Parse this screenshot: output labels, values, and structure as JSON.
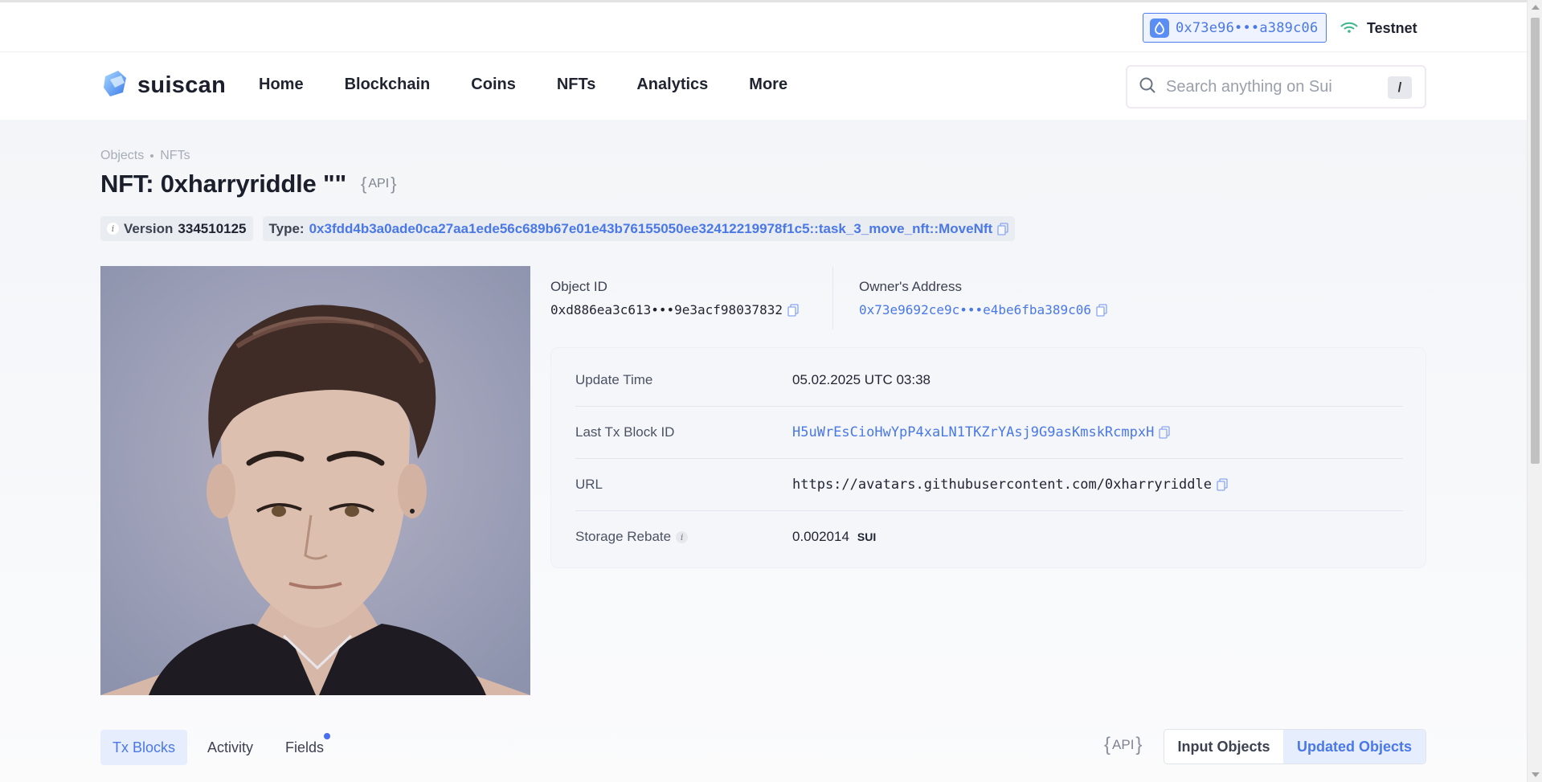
{
  "header": {
    "wallet_address": "0x73e96•••a389c06",
    "network": "Testnet"
  },
  "nav": {
    "logo_text": "suiscan",
    "links": [
      "Home",
      "Blockchain",
      "Coins",
      "NFTs",
      "Analytics",
      "More"
    ],
    "search_placeholder": "Search anything on Sui",
    "search_shortcut": "/"
  },
  "page": {
    "breadcrumb": [
      "Objects",
      "NFTs"
    ],
    "title": "NFT: 0xharryriddle \"\"",
    "api_label": "API",
    "version_label": "Version",
    "version_value": "334510125",
    "type_label": "Type:",
    "type_value": "0x3fdd4b3a0ade0ca27aa1ede56c689b67e01e43b76155050ee32412219978f1c5::task_3_move_nft::MoveNft"
  },
  "object": {
    "object_id_label": "Object ID",
    "object_id_value": "0xd886ea3c613•••9e3acf98037832",
    "owner_label": "Owner's Address",
    "owner_value": "0x73e9692ce9c•••e4be6fba389c06"
  },
  "details": [
    {
      "label": "Update Time",
      "value": "05.02.2025 UTC 03:38"
    },
    {
      "label": "Last Tx Block ID",
      "value": "H5uWrEsCioHwYpP4xaLN1TKZrYAsj9G9asKmskRcmpxH"
    },
    {
      "label": "URL",
      "value": "https://avatars.githubusercontent.com/0xharryriddle"
    },
    {
      "label": "Storage Rebate",
      "value": "0.002014",
      "unit": "SUI"
    }
  ],
  "tabs": {
    "items": [
      "Tx Blocks",
      "Activity",
      "Fields"
    ],
    "active": "Tx Blocks",
    "api_label": "API",
    "segments": [
      "Input Objects",
      "Updated Objects"
    ],
    "active_segment": "Updated Objects"
  },
  "colors": {
    "accent": "#4a78e6",
    "text": "#1f2430",
    "muted": "#a7adb7",
    "panel": "#f4f6fa"
  }
}
